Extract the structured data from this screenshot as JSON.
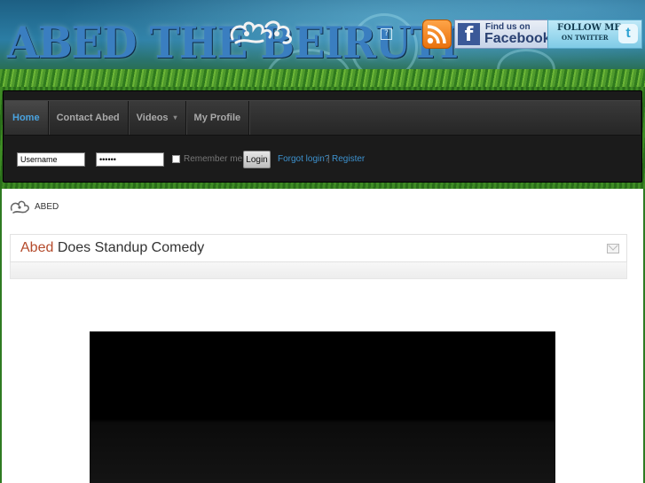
{
  "site": {
    "logo_text": "ABED THE BEIRUTI"
  },
  "social": {
    "rss": "rss-icon",
    "facebook": {
      "line1": "Find us on",
      "line2": "Facebook"
    },
    "twitter": {
      "line1": "FOLLOW ME",
      "line2": "ON TWITTER"
    }
  },
  "nav": {
    "items": [
      {
        "label": "Home",
        "active": true
      },
      {
        "label": "Contact Abed"
      },
      {
        "label": "Videos",
        "has_submenu": true
      },
      {
        "label": "My Profile"
      }
    ]
  },
  "login": {
    "username_value": "Username",
    "password_value": "••••••",
    "remember_label": "Remember me",
    "remember_checked": false,
    "button_label": "Login",
    "forgot_label": "Forgot login?",
    "separator": "|",
    "register_label": "Register"
  },
  "breadcrumb": {
    "label": "ABED"
  },
  "article": {
    "title_accent": "Abed",
    "title_rest": " Does Standup Comedy"
  },
  "colors": {
    "accent": "#4aa3df",
    "title_accent": "#b44a2b",
    "nav_bg": "#1b1b1b"
  }
}
